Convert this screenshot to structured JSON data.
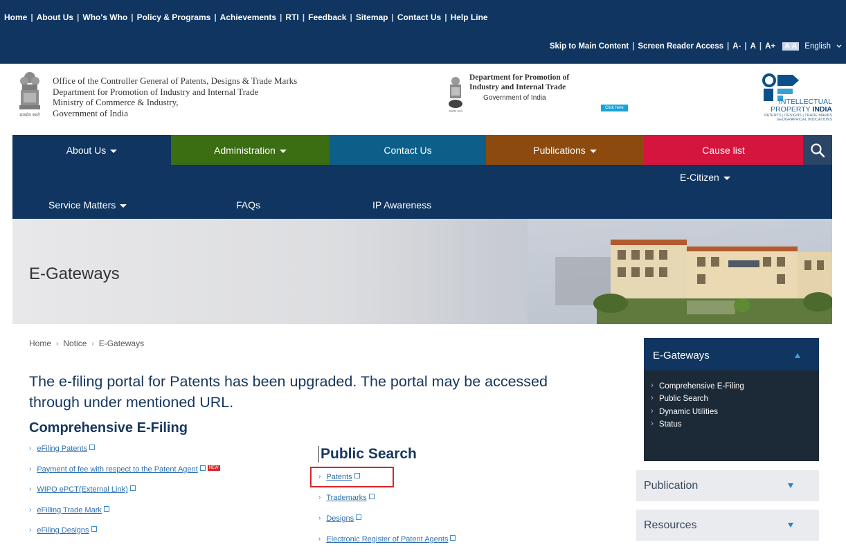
{
  "topnav": {
    "links": [
      "Home",
      "About Us",
      "Who's Who",
      "Policy & Programs",
      "Achievements",
      "RTI",
      "Feedback",
      "Sitemap",
      "Contact Us",
      "Help Line"
    ]
  },
  "accessbar": {
    "skip": "Skip to Main Content",
    "reader": "Screen Reader Access",
    "font_minus": "A-",
    "font_normal": "A",
    "font_plus": "A+",
    "contrast": "A A",
    "language": "English"
  },
  "header": {
    "office_lines": [
      "Office of the Controller General of Patents, Designs & Trade Marks",
      "Department for Promotion of Industry and Internal Trade",
      "Ministry of Commerce & Industry,",
      "Government of India"
    ],
    "dept_line1": "Department for Promotion of",
    "dept_line2": "Industry and Internal Trade",
    "dept_gov": "Government of India",
    "click_here": "Click here",
    "ipi_line1": "INTELLECTUAL",
    "ipi_line2a": "PROPERTY ",
    "ipi_line2b": "INDIA",
    "ipi_small1": "PATENTS | DESIGNS | TRADE MARKS",
    "ipi_small2": "GEOGRAPHICAL INDICATIONS",
    "emblem_caption": "सत्यमेव जयते"
  },
  "mainnav": {
    "about": "About Us",
    "administration": "Administration",
    "contact": "Contact Us",
    "publications": "Publications",
    "causelist": "Cause list",
    "ecitizen": "E-Citizen",
    "service": "Service Matters",
    "faqs": "FAQs",
    "ipawareness": "IP Awareness",
    "colors": {
      "administration": "#3b6d12",
      "contact": "#0d5f8a",
      "publications": "#8c4a0e",
      "causelist": "#d5153e",
      "navy": "#0f3560"
    }
  },
  "banner": {
    "title": "E-Gateways"
  },
  "breadcrumb": [
    "Home",
    "Notice",
    "E-Gateways"
  ],
  "content": {
    "heading": "The e-filing portal for Patents has been upgraded. The portal may be accessed through under mentioned URL.",
    "section1": "Comprehensive E-Filing",
    "links": [
      "eFiling Patents",
      "Payment of fee with respect to the Patent Agent",
      "WIPO ePCT(External Link)",
      "eFilling Trade Mark",
      "eFiling Designs"
    ],
    "new_badge": "NEW",
    "section2": "Public Search",
    "ps_links": [
      "Patents",
      "Trademarks",
      "Designs",
      "Electronic Register of Patent Agents"
    ]
  },
  "sidebar": {
    "title": "E-Gateways",
    "items": [
      "Comprehensive E-Filing",
      "Public Search",
      "Dynamic Utilities",
      "Status"
    ],
    "publication": "Publication",
    "resources": "Resources"
  }
}
